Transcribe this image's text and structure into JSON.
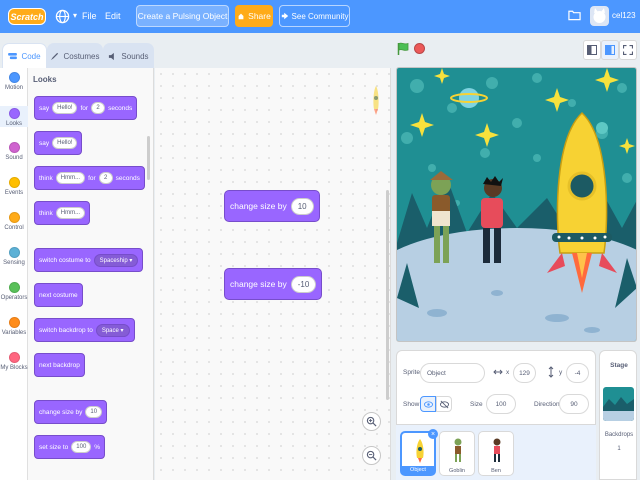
{
  "menubar": {
    "logo_text": "Scratch",
    "file_label": "File",
    "edit_label": "Edit",
    "project_title": "Create a Pulsing Object",
    "share_label": "Share",
    "community_label": "See Community",
    "username": "cel123"
  },
  "tabs": {
    "code": "Code",
    "costumes": "Costumes",
    "sounds": "Sounds"
  },
  "categories": [
    {
      "label": "Motion",
      "color": "#4c97ff"
    },
    {
      "label": "Looks",
      "color": "#9966ff"
    },
    {
      "label": "Sound",
      "color": "#cf63cf"
    },
    {
      "label": "Events",
      "color": "#ffbf00"
    },
    {
      "label": "Control",
      "color": "#ffab19"
    },
    {
      "label": "Sensing",
      "color": "#5cb1d6"
    },
    {
      "label": "Operators",
      "color": "#59c059"
    },
    {
      "label": "Variables",
      "color": "#ff8c1a"
    },
    {
      "label": "My Blocks",
      "color": "#ff6680"
    }
  ],
  "palette": {
    "heading": "Looks",
    "say_for": {
      "say": "say",
      "message": "Hello!",
      "for": "for",
      "secs": "2",
      "seconds": "seconds"
    },
    "say": {
      "say": "say",
      "message": "Hello!"
    },
    "think_for": {
      "think": "think",
      "message": "Hmm...",
      "for": "for",
      "secs": "2",
      "seconds": "seconds"
    },
    "think": {
      "think": "think",
      "message": "Hmm..."
    },
    "switch_costume": {
      "text": "switch costume to",
      "value": "Spaceship"
    },
    "next_costume": "next costume",
    "switch_backdrop": {
      "text": "switch backdrop to",
      "value": "Space"
    },
    "next_backdrop": "next backdrop",
    "change_size": {
      "text": "change size by",
      "value": "10"
    },
    "set_size": {
      "text": "set size to",
      "value": "100",
      "unit": "%"
    }
  },
  "code_area": {
    "block1": {
      "text": "change size by",
      "value": "10"
    },
    "block2": {
      "text": "change size by",
      "value": "-10"
    }
  },
  "sprite_info": {
    "sprite_label": "Sprite",
    "sprite_name": "Object",
    "x_label": "x",
    "x_value": "129",
    "y_label": "y",
    "y_value": "-4",
    "show_label": "Show",
    "size_label": "Size",
    "size_value": "100",
    "direction_label": "Direction",
    "direction_value": "90"
  },
  "sprites": [
    {
      "name": "Object"
    },
    {
      "name": "Goblin"
    },
    {
      "name": "Ben"
    }
  ],
  "stage_pane": {
    "title": "Stage",
    "backdrops_label": "Backdrops",
    "backdrops_count": "1"
  },
  "colors": {
    "menubar": "#4c97ff",
    "looks_block": "#9966ff",
    "share": "#ffab19",
    "stage_sky": "#1f8f93",
    "rocket": "#f7d233"
  }
}
